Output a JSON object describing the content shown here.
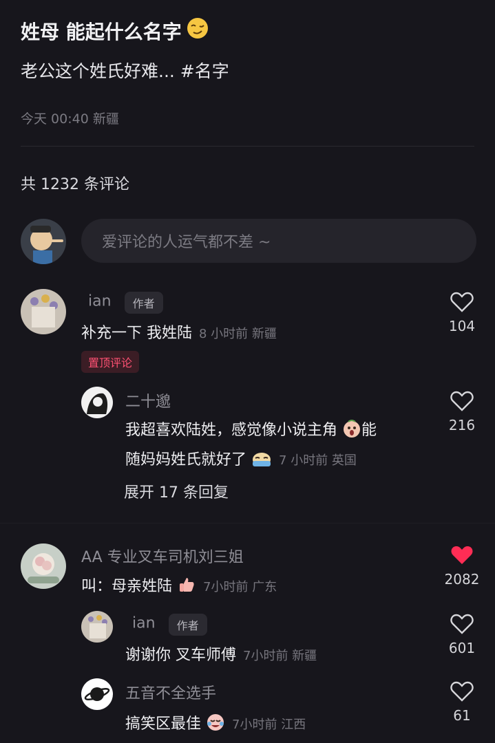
{
  "post": {
    "title": "姓母 能起什么名字",
    "title_emoji": "woozy-face-icon",
    "subtitle": "老公这个姓氏好难... #名字",
    "meta": "今天 00:40 新疆"
  },
  "comments_header": {
    "total": "共 1232 条评论"
  },
  "input": {
    "placeholder": "爱评论的人运气都不差 ~"
  },
  "comments": [
    {
      "name": "ian",
      "badge": "作者",
      "text": "补充一下 我姓陆",
      "time": "8 小时前 新疆",
      "likes": "104",
      "pin_label": "置顶评论"
    },
    {
      "name": "二十邈",
      "text_line1": "我超喜欢陆姓，感觉像小说主角",
      "text_line1_end": "能",
      "text_line2": "随妈妈姓氏就好了",
      "time": "7 小时前 英国",
      "likes": "216",
      "expand": "展开 17 条回复"
    },
    {
      "name": "AA 专业叉车司机刘三姐",
      "text": "叫：母亲姓陆",
      "time": "7小时前 广东",
      "likes": "2082",
      "liked": true
    },
    {
      "name": "ian",
      "badge": "作者",
      "text": "谢谢你 叉车师傅",
      "time": "7小时前 新疆",
      "likes": "601"
    },
    {
      "name": "五音不全选手",
      "text": "搞笑区最佳",
      "time": "7小时前 江西",
      "likes": "61"
    }
  ],
  "colors": {
    "background": "#17161c",
    "like_active": "#ff2d55",
    "pin_text": "#ff5173"
  }
}
